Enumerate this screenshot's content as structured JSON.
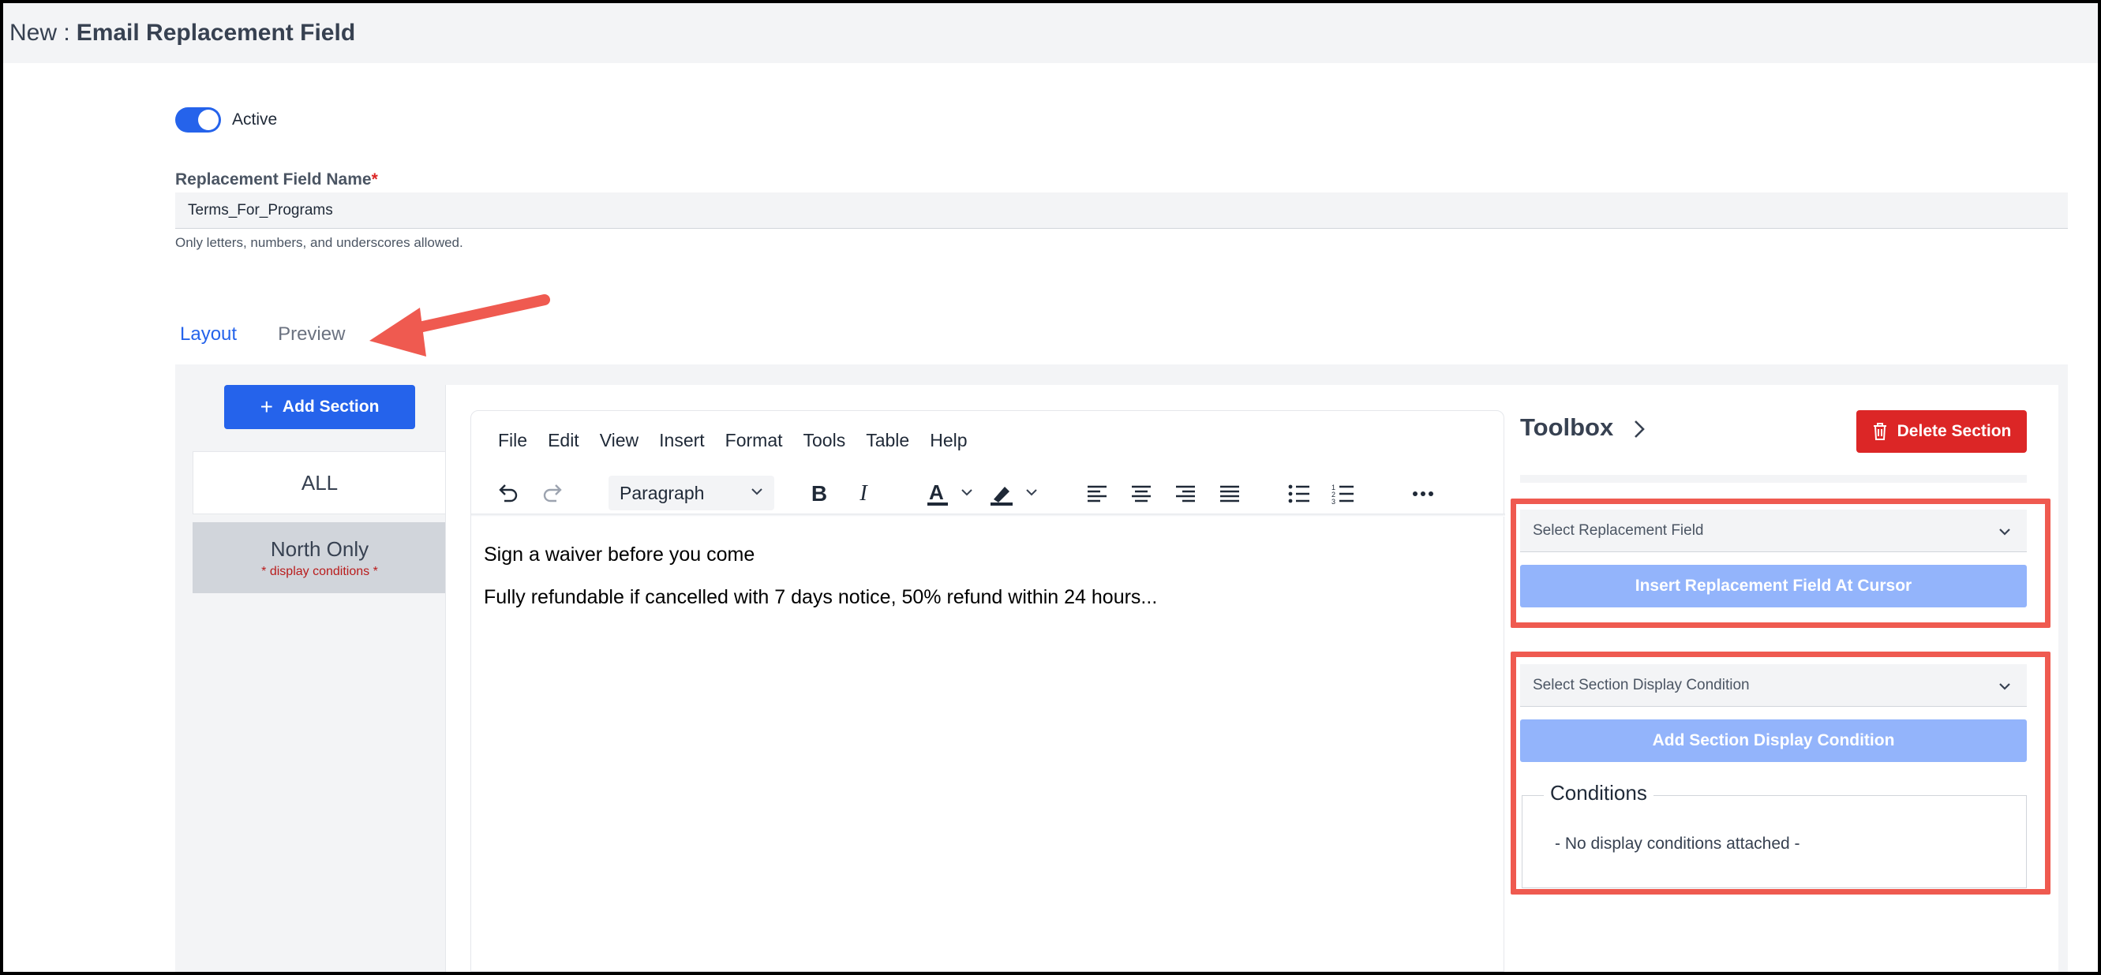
{
  "header": {
    "prefix": "New :",
    "title": "Email Replacement Field"
  },
  "active_toggle": {
    "label": "Active",
    "on": true
  },
  "name_field": {
    "label": "Replacement Field Name",
    "required_mark": "*",
    "value": "Terms_For_Programs",
    "help": "Only letters, numbers, and underscores allowed."
  },
  "tabs": [
    {
      "label": "Layout",
      "active": true
    },
    {
      "label": "Preview",
      "active": false
    }
  ],
  "sections": {
    "add_label": "Add Section",
    "items": [
      {
        "name": "ALL"
      },
      {
        "name": "North Only",
        "note": "* display conditions *"
      }
    ]
  },
  "editor": {
    "menu": [
      "File",
      "Edit",
      "Insert",
      "Format",
      "Tools",
      "Table",
      "Help"
    ],
    "view_menu": "View",
    "block_format": "Paragraph",
    "paragraphs": [
      "Sign a waiver before you come",
      "Fully refundable if cancelled with 7 days notice, 50% refund within 24 hours..."
    ]
  },
  "toolbox": {
    "title": "Toolbox",
    "delete_label": "Delete Section",
    "replacement_select_placeholder": "Select Replacement Field",
    "insert_label": "Insert Replacement Field At Cursor",
    "condition_select_placeholder": "Select Section Display Condition",
    "add_condition_label": "Add Section Display Condition",
    "conditions_title": "Conditions",
    "conditions_empty": "- No display conditions attached -"
  },
  "colors": {
    "primary": "#2563eb",
    "danger": "#dc2626",
    "disabled_primary": "#93b4fb",
    "annotation": "#ef5a50"
  }
}
